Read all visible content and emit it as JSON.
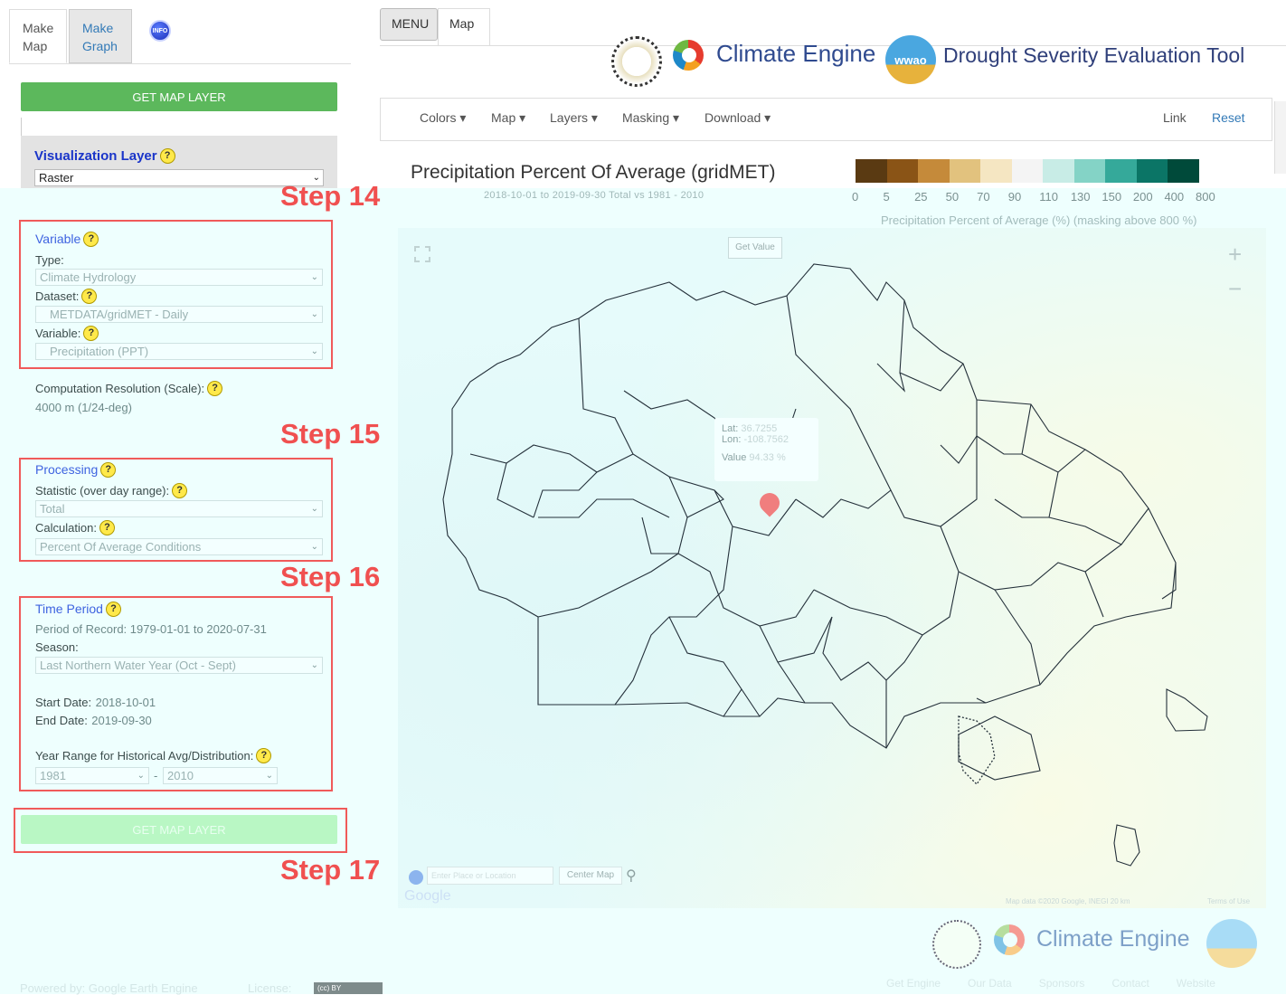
{
  "left_tabs": {
    "make_map": "Make Map",
    "make_graph": "Make Graph",
    "info": "INFO"
  },
  "get_map_layer": "GET MAP LAYER",
  "visualization": {
    "label": "Visualization Layer",
    "value": "Raster"
  },
  "variable_section": {
    "title": "Variable",
    "type_label": "Type:",
    "type_value": "Climate Hydrology",
    "dataset_label": "Dataset:",
    "dataset_value": "METDATA/gridMET - Daily",
    "variable_label": "Variable:",
    "variable_value": "Precipitation (PPT)"
  },
  "resolution": {
    "label": "Computation Resolution (Scale):",
    "value": "4000 m (1/24-deg)"
  },
  "processing": {
    "title": "Processing",
    "statistic_label": "Statistic (over day range):",
    "statistic_value": "Total",
    "calculation_label": "Calculation:",
    "calculation_value": "Percent Of Average Conditions"
  },
  "time_period": {
    "title": "Time Period",
    "period_of_record": "Period of Record: 1979-01-01 to 2020-07-31",
    "season_label": "Season:",
    "season_value": "Last Northern Water Year (Oct - Sept)",
    "start_label": "Start Date:",
    "start_value": "2018-10-01",
    "end_label": "End Date:",
    "end_value": "2019-09-30",
    "year_range_label": "Year Range for Historical Avg/Distribution:",
    "year_start": "1981",
    "year_sep": "-",
    "year_end": "2010"
  },
  "steps": {
    "s14": "Step 14",
    "s15": "Step 15",
    "s16": "Step 16",
    "s17": "Step 17"
  },
  "footer_left": {
    "powered": "Powered by: Google Earth Engine",
    "license": "License:",
    "cc": "(cc) BY"
  },
  "right_tabs": {
    "menu": "MENU",
    "map": "Map"
  },
  "header": {
    "brand": "Climate Engine",
    "wwao": "wwao",
    "tool_title": "Drought Severity Evaluation Tool"
  },
  "navbar": {
    "colors": "Colors",
    "map": "Map",
    "layers": "Layers",
    "masking": "Masking",
    "download": "Download",
    "link": "Link",
    "reset": "Reset"
  },
  "map_title": "Precipitation Percent Of Average (gridMET)",
  "map_subtitle": "2018-10-01 to 2019-09-30  Total  vs  1981 - 2010",
  "legend": {
    "colors": [
      "#5a3a12",
      "#8a5416",
      "#c58a3a",
      "#e2c27e",
      "#f5e6c2",
      "#f4f4f4",
      "#c8ece6",
      "#84d3c6",
      "#35a99a",
      "#0b7566",
      "#004a3a"
    ],
    "ticks": [
      "0",
      "5",
      "25",
      "50",
      "70",
      "90",
      "110",
      "130",
      "150",
      "200",
      "400",
      "800"
    ],
    "caption": "Precipitation Percent of Average (%) (masking above 800 %)"
  },
  "map": {
    "get_value": "Get Value",
    "lat_label": "Lat:",
    "lat_value": "36.7255",
    "lon_label": "Lon:",
    "lon_value": "-108.7562",
    "value_label": "Value",
    "value_value": "94.33 %",
    "zoom_in": "+",
    "zoom_out": "−",
    "center_map": "Center Map",
    "search_placeholder": "Enter Place or Location",
    "google": "Google",
    "attribution": "Map data ©2020 Google, INEGI   20 km",
    "terms": "Terms of Use"
  },
  "footer_right": {
    "brand": "Climate Engine",
    "links": [
      "Get Engine",
      "Our Data",
      "Sponsors",
      "Contact",
      "Website"
    ]
  }
}
